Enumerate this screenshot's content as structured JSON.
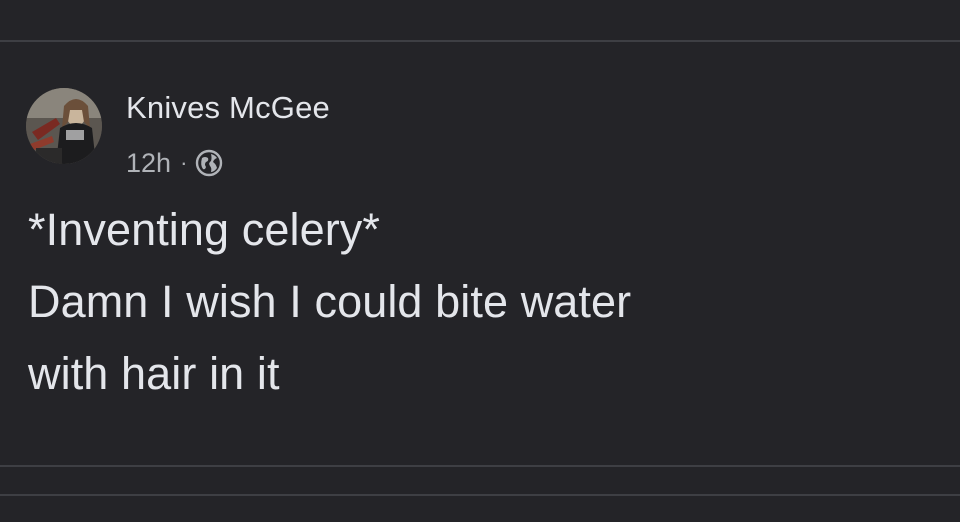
{
  "post": {
    "author_name": "Knives McGee",
    "timestamp": "12h",
    "separator": "·",
    "audience_icon": "globe-icon",
    "body_lines": [
      "*Inventing celery*",
      "Damn I wish I could bite water",
      "with hair in it"
    ]
  },
  "colors": {
    "background": "#242428",
    "divider": "#3e3f44",
    "primary_text": "#e4e6eb",
    "secondary_text": "#b0b3b8"
  }
}
